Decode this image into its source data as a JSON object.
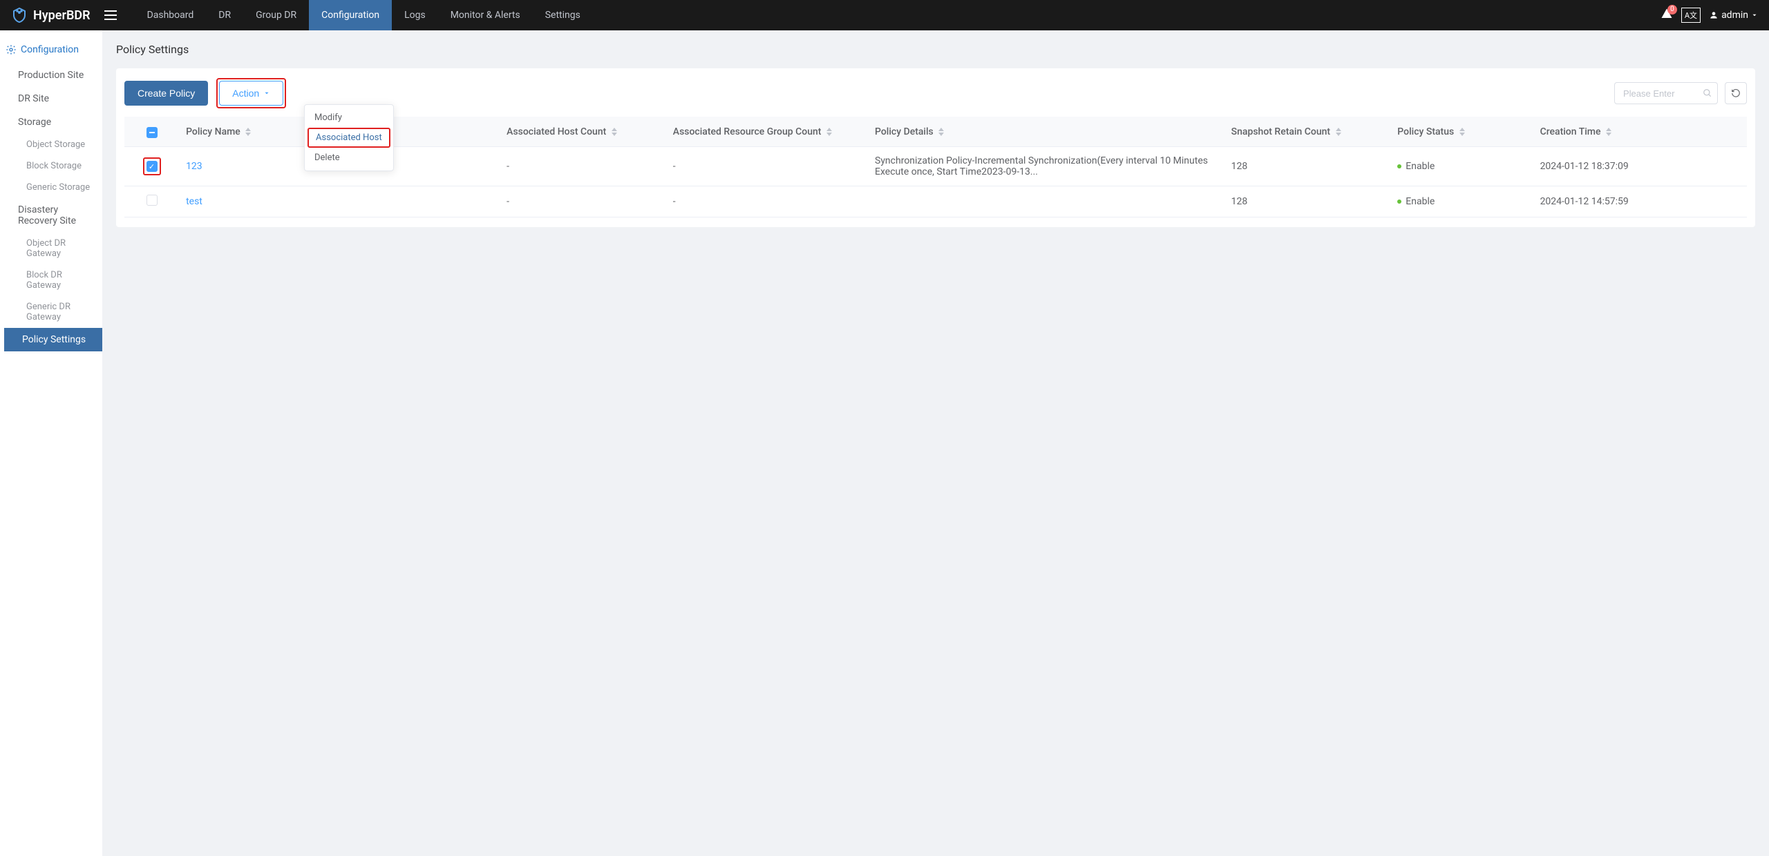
{
  "header": {
    "brand": "HyperBDR",
    "nav": [
      {
        "label": "Dashboard"
      },
      {
        "label": "DR"
      },
      {
        "label": "Group DR"
      },
      {
        "label": "Configuration",
        "active": true
      },
      {
        "label": "Logs"
      },
      {
        "label": "Monitor & Alerts"
      },
      {
        "label": "Settings"
      }
    ],
    "alert_count": "0",
    "lang": "A文",
    "user": "admin"
  },
  "sidebar": {
    "title": "Configuration",
    "items": [
      {
        "label": "Production Site",
        "level": 1
      },
      {
        "label": "DR Site",
        "level": 1
      },
      {
        "label": "Storage",
        "level": 1
      },
      {
        "label": "Object Storage",
        "level": 2
      },
      {
        "label": "Block Storage",
        "level": 2
      },
      {
        "label": "Generic Storage",
        "level": 2
      },
      {
        "label": "Disastery Recovery Site",
        "level": 1
      },
      {
        "label": "Object DR Gateway",
        "level": 2
      },
      {
        "label": "Block DR Gateway",
        "level": 2
      },
      {
        "label": "Generic DR Gateway",
        "level": 2
      },
      {
        "label": "Policy Settings",
        "level": 1,
        "active": true
      }
    ]
  },
  "page": {
    "title": "Policy Settings"
  },
  "toolbar": {
    "create_label": "Create Policy",
    "action_label": "Action",
    "search_placeholder": "Please Enter"
  },
  "dropdown": {
    "items": [
      {
        "label": "Modify"
      },
      {
        "label": "Associated Host",
        "highlighted": true
      },
      {
        "label": "Delete"
      }
    ]
  },
  "table": {
    "headers": {
      "policy_name": "Policy Name",
      "host_count": "Associated Host Count",
      "resource_group_count": "Associated Resource Group Count",
      "policy_details": "Policy Details",
      "snapshot_count": "Snapshot Retain Count",
      "policy_status": "Policy Status",
      "creation_time": "Creation Time"
    },
    "rows": [
      {
        "checked": true,
        "highlighted": true,
        "name": "123",
        "host_count": "-",
        "resource_group_count": "-",
        "details": "Synchronization Policy-Incremental Synchronization(Every interval 10 Minutes Execute once, Start Time2023-09-13...",
        "snapshot_count": "128",
        "status": "Enable",
        "creation_time": "2024-01-12 18:37:09"
      },
      {
        "checked": false,
        "name": "test",
        "host_count": "-",
        "resource_group_count": "-",
        "details": "",
        "snapshot_count": "128",
        "status": "Enable",
        "creation_time": "2024-01-12 14:57:59"
      }
    ]
  }
}
